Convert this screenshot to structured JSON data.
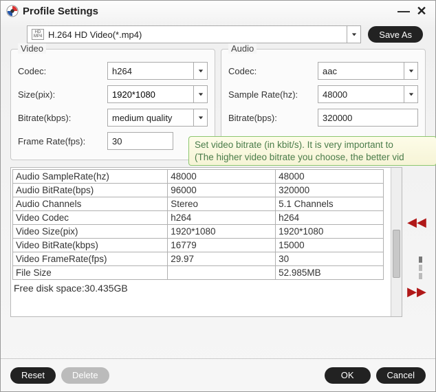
{
  "window": {
    "title": "Profile Settings"
  },
  "profile": {
    "selected": "H.264 HD Video(*.mp4)",
    "format_badge_top": "HD",
    "format_badge_bot": "MP4",
    "save_as": "Save As"
  },
  "video": {
    "group_title": "Video",
    "codec_label": "Codec:",
    "codec_value": "h264",
    "size_label": "Size(pix):",
    "size_value": "1920*1080",
    "bitrate_label": "Bitrate(kbps):",
    "bitrate_value": "medium quality",
    "framerate_label": "Frame Rate(fps):",
    "framerate_value": "30"
  },
  "audio": {
    "group_title": "Audio",
    "codec_label": "Codec:",
    "codec_value": "aac",
    "samplerate_label": "Sample Rate(hz):",
    "samplerate_value": "48000",
    "bitrate_label": "Bitrate(bps):",
    "bitrate_value": "320000"
  },
  "tooltip": {
    "line1": "Set video bitrate (in kbit/s). It is very important to ",
    "line2": "(The higher video bitrate you choose, the better vid"
  },
  "comparison": {
    "rows": [
      {
        "label": "Audio SampleRate(hz)",
        "c1": "48000",
        "c2": "48000"
      },
      {
        "label": "Audio BitRate(bps)",
        "c1": "96000",
        "c2": "320000"
      },
      {
        "label": "Audio Channels",
        "c1": "Stereo",
        "c2": "5.1 Channels"
      },
      {
        "label": "Video Codec",
        "c1": "h264",
        "c2": "h264"
      },
      {
        "label": "Video Size(pix)",
        "c1": "1920*1080",
        "c2": "1920*1080"
      },
      {
        "label": "Video BitRate(kbps)",
        "c1": "16779",
        "c2": "15000"
      },
      {
        "label": "Video FrameRate(fps)",
        "c1": "29.97",
        "c2": "30"
      },
      {
        "label": "File Size",
        "c1": "",
        "c2": "52.985MB"
      }
    ],
    "free_disk": "Free disk space:30.435GB"
  },
  "buttons": {
    "reset": "Reset",
    "delete": "Delete",
    "ok": "OK",
    "cancel": "Cancel"
  },
  "icons": {
    "minimize": "—",
    "close": "✕"
  }
}
